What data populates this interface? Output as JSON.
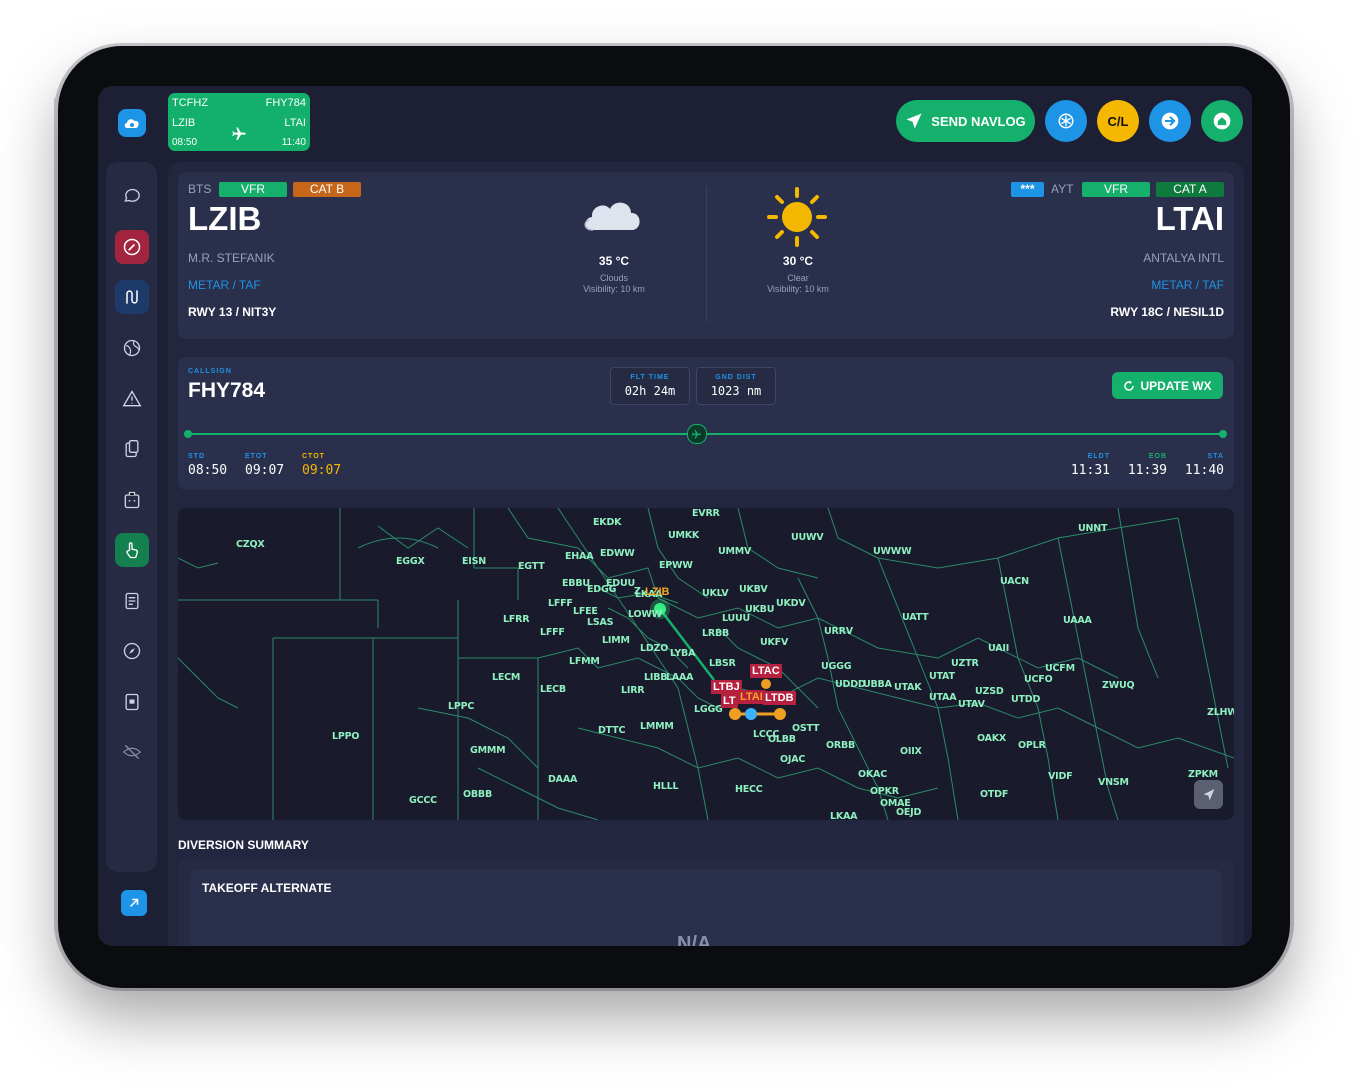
{
  "header": {
    "flight": {
      "reg": "TCFHZ",
      "callsign": "FHY784",
      "dep": "LZIB",
      "arr": "LTAI",
      "dep_time": "08:50",
      "arr_time": "11:40"
    },
    "send_navlog_label": "SEND NAVLOG",
    "checklist_label": "C/L",
    "colors": {
      "green": "#14b06c",
      "blue": "#1e94e6",
      "yellow": "#f5b800"
    }
  },
  "departure": {
    "iata": "BTS",
    "flight_rules": "VFR",
    "category": "CAT B",
    "icao": "LZIB",
    "name": "M.R. STEFANIK",
    "metar_link": "METAR / TAF",
    "runway": "RWY 13 / NIT3Y",
    "wx": {
      "temp": "35 °C",
      "condition": "Clouds",
      "visibility": "Visibility: 10 km",
      "icon": "cloud-icon"
    }
  },
  "arrival": {
    "badge": "***",
    "iata": "AYT",
    "flight_rules": "VFR",
    "category": "CAT A",
    "icao": "LTAI",
    "name": "ANTALYA INTL",
    "metar_link": "METAR / TAF",
    "runway": "RWY 18C / NESIL1D",
    "wx": {
      "temp": "30 °C",
      "condition": "Clear",
      "visibility": "Visibility: 10 km",
      "icon": "sun-icon"
    }
  },
  "flight_bar": {
    "callsign_label": "CALLSIGN",
    "callsign": "FHY784",
    "flt_time_label": "FLT TIME",
    "flt_time": "02h 24m",
    "gnd_dist_label": "GND DIST",
    "gnd_dist": "1023 nm",
    "update_wx_label": "UPDATE WX",
    "progress": 0.49,
    "times": [
      {
        "label": "STD",
        "value": "08:50",
        "color": "#1e94e6"
      },
      {
        "label": "ETOT",
        "value": "09:07",
        "color": "#1e94e6"
      },
      {
        "label": "CTOT",
        "value": "09:07",
        "color": "#f5b800"
      },
      {
        "label": "ELDT",
        "value": "11:31",
        "color": "#1e94e6"
      },
      {
        "label": "EOB",
        "value": "11:39",
        "color": "#14b06c"
      },
      {
        "label": "STA",
        "value": "11:40",
        "color": "#1e94e6"
      }
    ]
  },
  "map": {
    "firs": [
      "CZQX",
      "EGGX",
      "EISN",
      "EGTT",
      "EKDK",
      "EVRR",
      "UMKK",
      "UUWV",
      "UNNT",
      "EHAA",
      "EDWW",
      "EPWW",
      "UMMV",
      "UWWW",
      "EBBU",
      "EDGG",
      "EDUU",
      "UKLV",
      "UKBV",
      "UACN",
      "LFFF",
      "LFEE",
      "LOWW",
      "LKAA",
      "UKDV",
      "LFRR",
      "LSAS",
      "LFFF",
      "LIMM",
      "UKBU",
      "LUUU",
      "URRV",
      "UATT",
      "UAAA",
      "LRBB",
      "UKFV",
      "UAII",
      "LECM",
      "LFMM",
      "LDZO",
      "LYBA",
      "LBSR",
      "UGGG",
      "UZTR",
      "UCFM",
      "LECB",
      "LIBB",
      "LAAA",
      "UDDD",
      "UBBA",
      "UTAK",
      "UTAT",
      "UCFO",
      "ZWUQ",
      "LPPC",
      "LIRR",
      "LGGG",
      "UTAA",
      "UZSD",
      "UTAV",
      "UTDD",
      "ZLHW",
      "LPPO",
      "DTTC",
      "LMMM",
      "OSTT",
      "OAKX",
      "OPLR",
      "GMMM",
      "LCCC",
      "OLBB",
      "ORBB",
      "OIIX",
      "DAAA",
      "OJAC",
      "HLLL",
      "HECC",
      "OKAC",
      "VIDF",
      "VNSM",
      "ZPKM",
      "GCCC",
      "OBBB",
      "OPKR",
      "OTDF",
      "OMAE",
      "OEJD",
      "LKAA",
      "Z"
    ],
    "route": {
      "dep": "LZIB",
      "arr": "LTAI",
      "alternates": [
        "LTAC",
        "LTBJ",
        "LTDB",
        "LT"
      ]
    }
  },
  "diversion": {
    "section_title": "DIVERSION SUMMARY",
    "takeoff_alt_title": "TAKEOFF ALTERNATE",
    "empty_value": "N/A"
  },
  "sidebar_icons": [
    "chat-icon",
    "gauge-icon",
    "route-icon",
    "globe-icon",
    "warning-icon",
    "clipboard-icon",
    "briefcase-icon",
    "touch-icon",
    "checklist-icon",
    "compass-icon",
    "tablet-icon",
    "eye-off-icon"
  ]
}
